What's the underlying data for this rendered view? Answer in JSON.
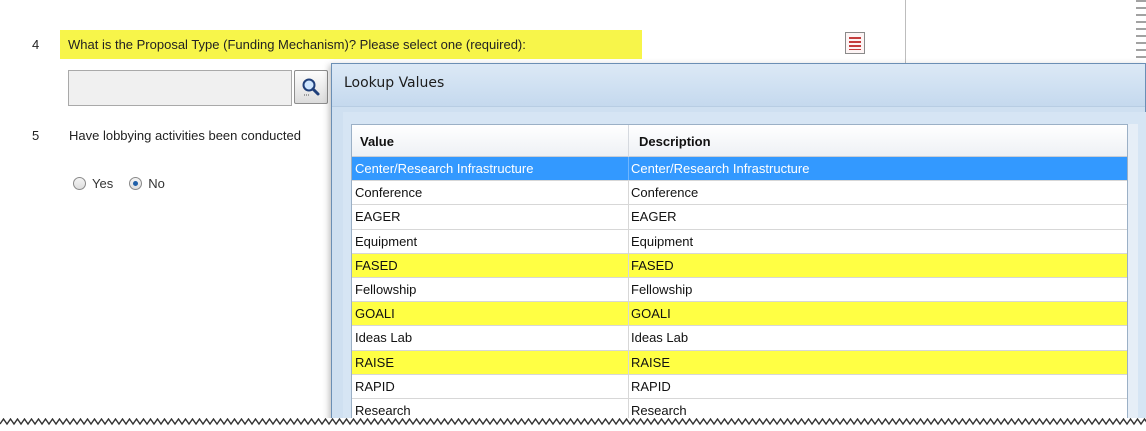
{
  "questions": [
    {
      "number": "4",
      "text": "What is the Proposal Type (Funding Mechanism)? Please select one (required):"
    },
    {
      "number": "5",
      "text": "Have lobbying activities been conducted"
    }
  ],
  "lookup_field": {
    "value": "",
    "placeholder": ""
  },
  "lobbying_radio": {
    "options": [
      "Yes",
      "No"
    ],
    "selected": "No"
  },
  "dialog": {
    "title": "Lookup Values",
    "columns": [
      "Value",
      "Description"
    ],
    "rows": [
      {
        "value": "Center/Research Infrastructure",
        "description": "Center/Research Infrastructure",
        "state": "selected"
      },
      {
        "value": "Conference",
        "description": "Conference",
        "state": ""
      },
      {
        "value": "EAGER",
        "description": "EAGER",
        "state": ""
      },
      {
        "value": "Equipment",
        "description": "Equipment",
        "state": ""
      },
      {
        "value": "FASED",
        "description": "FASED",
        "state": "highlight"
      },
      {
        "value": "Fellowship",
        "description": "Fellowship",
        "state": ""
      },
      {
        "value": "GOALI",
        "description": "GOALI",
        "state": "highlight"
      },
      {
        "value": "Ideas Lab",
        "description": "Ideas Lab",
        "state": ""
      },
      {
        "value": "RAISE",
        "description": "RAISE",
        "state": "highlight"
      },
      {
        "value": "RAPID",
        "description": "RAPID",
        "state": ""
      },
      {
        "value": "Research",
        "description": "Research",
        "state": ""
      }
    ]
  },
  "colors": {
    "question_highlight": "#f7f54a",
    "selected_row": "#3399ff",
    "highlight_row": "#ffff44",
    "dialog_background": "#cfe0f1"
  },
  "icons": {
    "lookup_button": "magnifier-icon",
    "help": "document-help-icon"
  }
}
